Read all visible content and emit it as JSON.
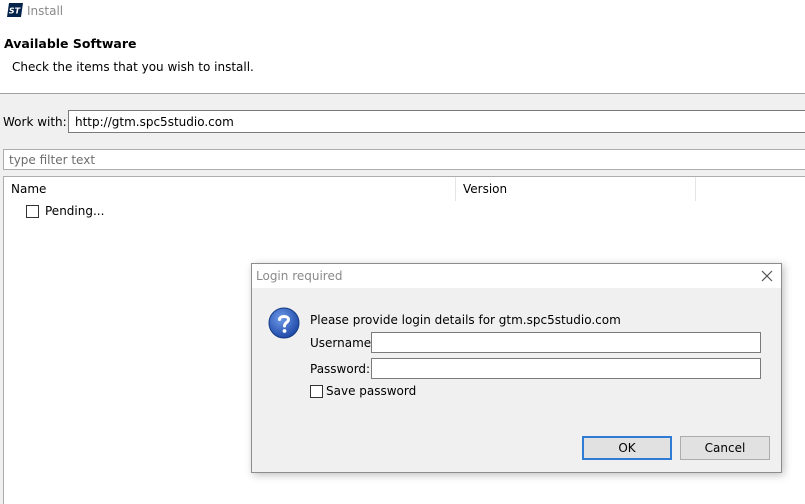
{
  "window": {
    "title": "Install",
    "logo_text": "ST"
  },
  "header": {
    "title": "Available Software",
    "subtitle": "Check the items that you wish to install."
  },
  "workwith": {
    "label": "Work with:",
    "value": "http://gtm.spc5studio.com"
  },
  "filter": {
    "placeholder": "type filter text"
  },
  "tree": {
    "columns": [
      "Name",
      "Version"
    ],
    "rows": [
      {
        "label": "Pending..."
      }
    ]
  },
  "dialog": {
    "title": "Login required",
    "icon": "question-icon",
    "prompt": "Please provide login details for gtm.spc5studio.com",
    "username_label": "Username:",
    "username_value": "",
    "password_label": "Password:",
    "password_value": "",
    "save_password_label": "Save password",
    "ok_label": "OK",
    "cancel_label": "Cancel"
  },
  "colors": {
    "accent": "#2f7cd6",
    "logo": "#03234b",
    "question_icon": "#1f4aa8"
  }
}
